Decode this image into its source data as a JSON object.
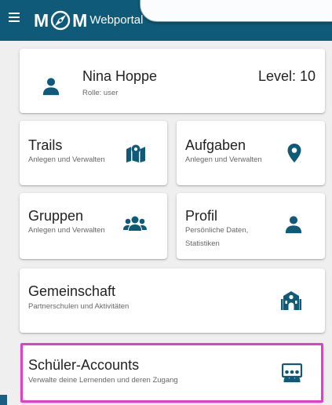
{
  "header": {
    "logo_left": "M",
    "logo_right": "M",
    "app_name": "Webportal",
    "icons": {
      "menu": "menu-icon",
      "logo_center": "compass-icon"
    }
  },
  "user": {
    "name": "Nina Hoppe",
    "role": "Rolle: user",
    "level": "Level: 10",
    "icon": "person-icon"
  },
  "cards": {
    "trails": {
      "title": "Trails",
      "subtitle": "Anlegen und Verwalten",
      "icon": "map-icon"
    },
    "aufgaben": {
      "title": "Aufgaben",
      "subtitle": "Anlegen und Verwalten",
      "icon": "location-pin-icon"
    },
    "gruppen": {
      "title": "Gruppen",
      "subtitle": "Anlegen und Verwalten",
      "icon": "users-icon"
    },
    "profil": {
      "title": "Profil",
      "subtitle_line1": "Persönliche Daten,",
      "subtitle_line2": "Statistiken",
      "icon": "person-icon"
    },
    "gemeinschaft": {
      "title": "Gemeinschaft",
      "subtitle": "Partnerschulen und Aktivitäten",
      "icon": "school-icon"
    },
    "schueler": {
      "title": "Schüler-Accounts",
      "subtitle": "Verwalte deine Lernenden und deren Zugang",
      "icon": "classroom-icon"
    }
  },
  "colors": {
    "appbar": "#0e5a78",
    "icon": "#0e5a78",
    "highlight": "#e040c8",
    "background": "#efefef"
  }
}
